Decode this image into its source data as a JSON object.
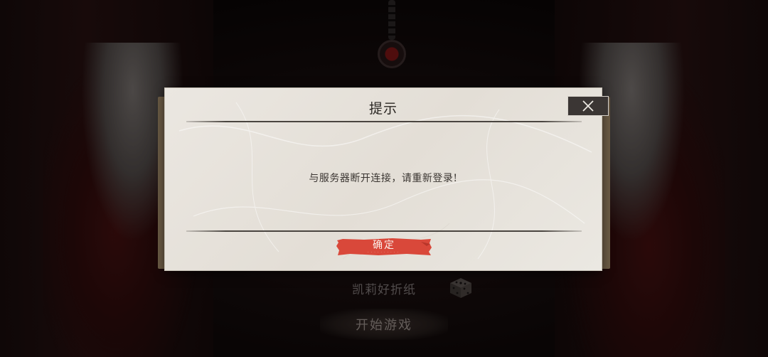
{
  "background": {
    "character_name": "凯莉好折纸",
    "start_label": "开始游戏"
  },
  "dialog": {
    "title": "提示",
    "message": "与服务器断开连接，请重新登录!",
    "confirm_label": "确定",
    "confirm_subtext": "··········"
  },
  "colors": {
    "dialog_paper": "#e8e4dd",
    "confirm_red": "#d9483a",
    "close_bg": "#3b3634",
    "background": "#0b0707"
  },
  "icons": {
    "close": "close-icon",
    "dice": "dice-icon"
  }
}
